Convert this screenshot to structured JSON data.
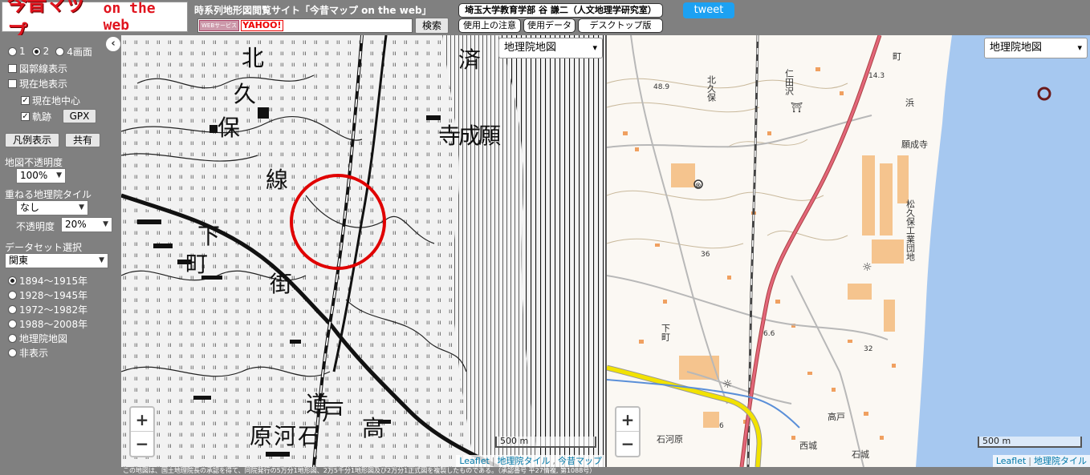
{
  "header": {
    "logo_main": "今昔マップ",
    "logo_sub": "on the web",
    "site_title": "時系列地形図閲覧サイト「今昔マップ on the web」",
    "search_brand_web": "WEBサービス",
    "search_brand_yahoo": "YAHOO!",
    "search_value": "",
    "search_button": "検索",
    "author_link": "埼玉大学教育学部 谷 謙二（人文地理学研究室）",
    "notes_link": "使用上の注意",
    "data_link": "使用データ",
    "desktop_link": "デスクトップ版",
    "tweet_label": "tweet"
  },
  "sidebar": {
    "collapse_icon": "‹",
    "screens": [
      {
        "label": "1",
        "checked": false
      },
      {
        "label": "2",
        "checked": true
      },
      {
        "label": "4画面",
        "checked": false
      }
    ],
    "grid_lines": "図郭線表示",
    "show_location": "現在地表示",
    "center_location": "現在地中心",
    "track": "軌跡",
    "gpx_button": "GPX",
    "legend_button": "凡例表示",
    "share_button": "共有",
    "opacity_label": "地図不透明度",
    "opacity_value": "100%",
    "overlay_label": "重ねる地理院タイル",
    "overlay_value": "なし",
    "overlay_opacity_label": "不透明度",
    "overlay_opacity_value": "20%",
    "dataset_label": "データセット選択",
    "dataset_value": "関東",
    "eras": [
      {
        "label": "1894～1915年",
        "checked": true
      },
      {
        "label": "1928～1945年",
        "checked": false
      },
      {
        "label": "1972～1982年",
        "checked": false
      },
      {
        "label": "1988～2008年",
        "checked": false
      },
      {
        "label": "地理院地図",
        "checked": false
      },
      {
        "label": "非表示",
        "checked": false
      }
    ]
  },
  "map_left": {
    "layer_select": "地理院地図",
    "zoom_in": "+",
    "zoom_out": "−",
    "scale": "500 m",
    "attr_leaflet": "Leaflet",
    "attr_tiles": "地理院タイル",
    "attr_konjaku": "今昔マップ",
    "labels": [
      "北",
      "久",
      "保",
      "線",
      "下",
      "町",
      "街",
      "道",
      "原",
      "河",
      "石",
      "戸",
      "高",
      "済",
      "寺",
      "成",
      "願"
    ]
  },
  "map_right": {
    "layer_select": "地理院地図",
    "zoom_in": "+",
    "zoom_out": "−",
    "scale": "500 m",
    "attr_leaflet": "Leaflet",
    "attr_tiles": "地理院タイル",
    "labels": {
      "kitakubo": "北久保",
      "nitasawa": "仁田沢",
      "machi": "町",
      "hama": "浜",
      "ganjoji": "願成寺",
      "industrial": "松久保工業団地",
      "shitamachi": "下町",
      "takado": "高戸",
      "ishikawara": "石河原",
      "nishishiro": "西城",
      "ishishiro": "石城",
      "elev1": "48.9",
      "elev2": "14.3",
      "elev3": "36",
      "elev4": "6.6",
      "elev5": "32",
      "elev6": "6"
    }
  },
  "footer": {
    "note": "この地図は、国土地理院長の承認を得て、同院発行の5万分1地形図、2万5千分1地形図及び2万分1正式図を複製したものである。（承認番号 平27情複, 第1088号）"
  },
  "colors": {
    "brand_red": "#e0141e",
    "panel_gray": "#808080",
    "tweet_blue": "#1da1f2",
    "sea_blue": "#a6c8f0",
    "road_red": "#e4667a",
    "highway_yellow": "#f2e200",
    "marker_red": "#e00000"
  }
}
